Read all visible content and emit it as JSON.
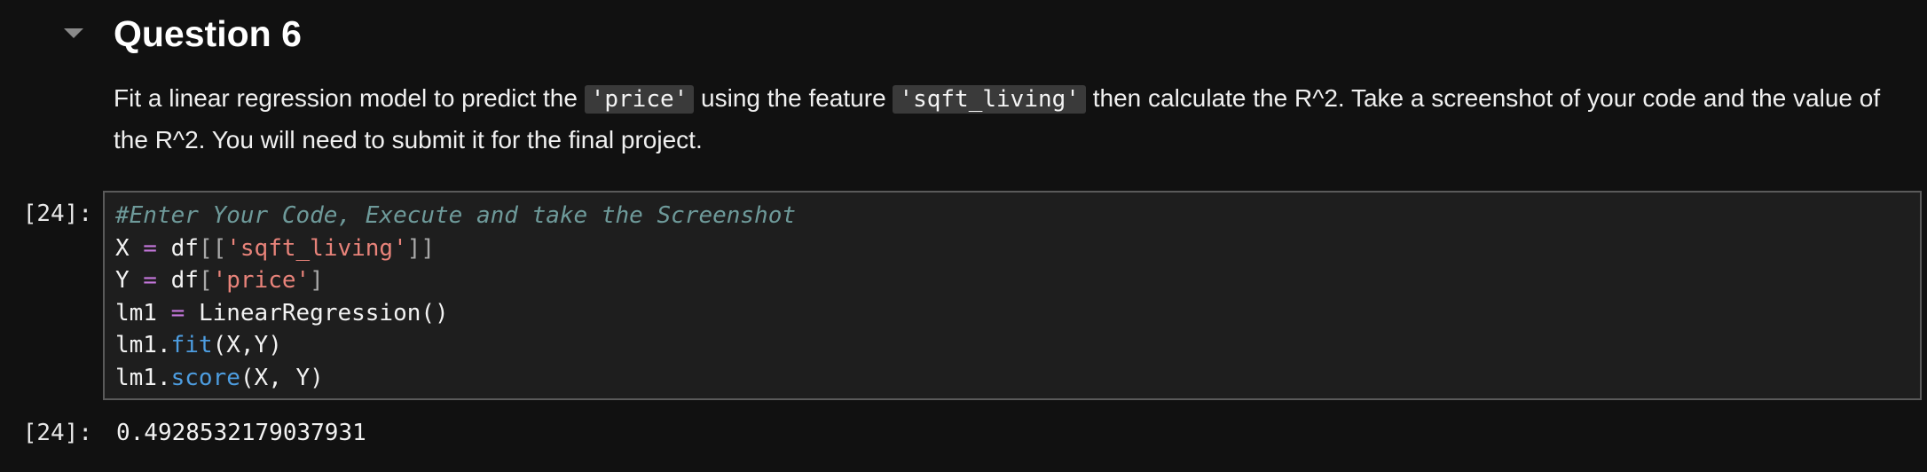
{
  "section": {
    "toggle_icon": "chevron-down-icon",
    "heading": "Question 6"
  },
  "prose": {
    "part1": "Fit a linear regression model to predict the ",
    "code1": "'price'",
    "part2": " using the feature ",
    "code2": "'sqft_living'",
    "part3": " then calculate the R^2. Take a screenshot of your code and the value of the R^2. You will need to submit it for the final project."
  },
  "cell": {
    "input_prompt": "[24]:",
    "output_prompt": "[24]:",
    "code": {
      "line1": {
        "comment": "#Enter Your Code, Execute and take the Screenshot"
      },
      "line2": {
        "var": "X",
        "op": " = ",
        "obj": "df",
        "open": "[[",
        "str": "'sqft_living'",
        "close": "]]"
      },
      "line3": {
        "var": "Y",
        "op": " = ",
        "obj": "df",
        "open": "[",
        "str": "'price'",
        "close": "]"
      },
      "line4": {
        "var": "lm1",
        "op": " = ",
        "call": "LinearRegression()"
      },
      "line5": {
        "obj": "lm1",
        "dot": ".",
        "method": "fit",
        "args": "(X,Y)"
      },
      "line6": {
        "obj": "lm1",
        "dot": ".",
        "method": "score",
        "args": "(X, Y)"
      }
    },
    "output": "0.4928532179037931"
  },
  "colors": {
    "background": "#111111",
    "editor_background": "#1e1e1e",
    "editor_border": "#5a5a5a",
    "comment": "#6e9a9a",
    "operator": "#c678dd",
    "string": "#e8837a",
    "method": "#4d9de0"
  }
}
